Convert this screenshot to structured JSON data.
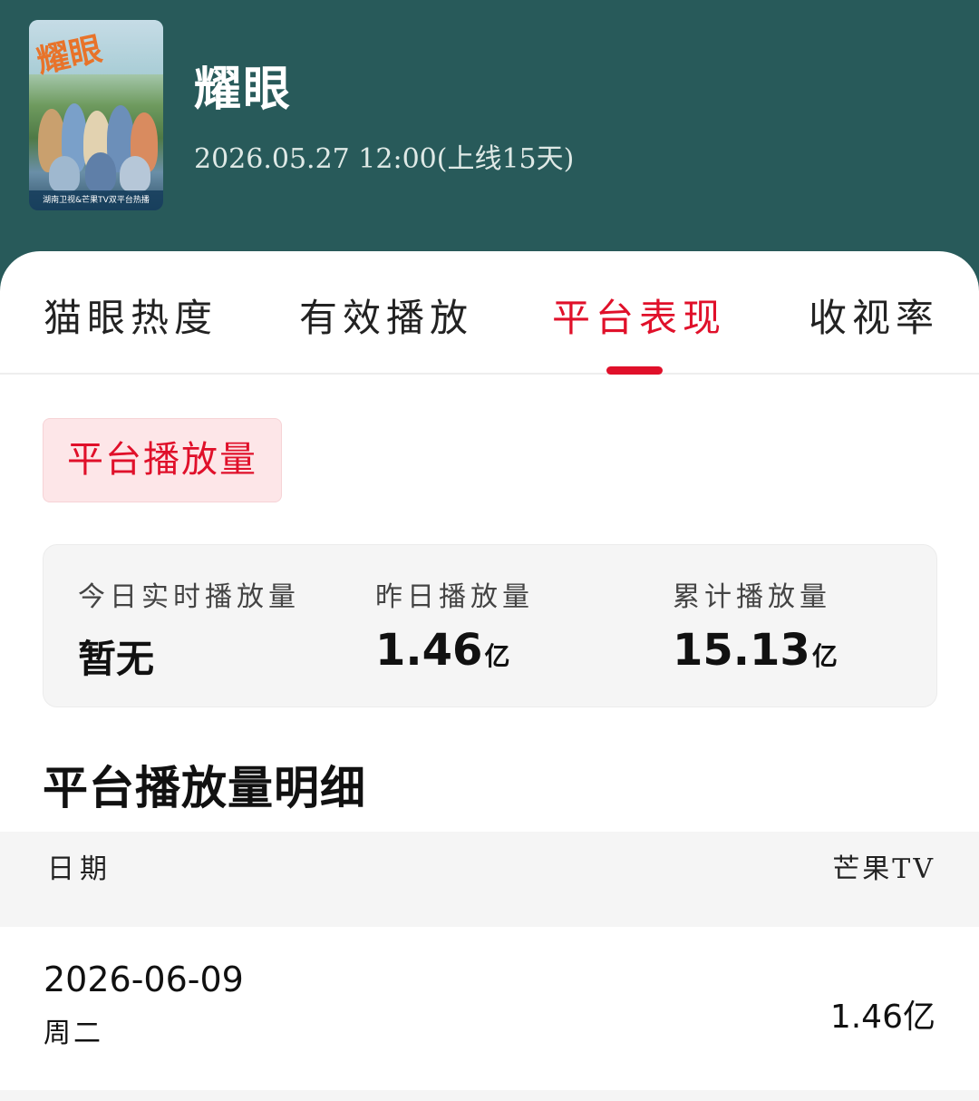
{
  "header": {
    "title": "耀眼",
    "release": "2026.05.27 12:00(上线15天)",
    "poster": {
      "brand_text": "耀眼",
      "bottom_text": "湖南卫视&芒果TV双平台热播"
    }
  },
  "tabs": [
    {
      "label": "猫眼热度",
      "active": false
    },
    {
      "label": "有效播放",
      "active": false
    },
    {
      "label": "平台表现",
      "active": true
    },
    {
      "label": "收视率",
      "active": false
    }
  ],
  "filter": {
    "label": "平台播放量"
  },
  "stats": {
    "today": {
      "label": "今日实时播放量",
      "value": "暂无"
    },
    "yesterday": {
      "label": "昨日播放量",
      "value": "1.46",
      "unit": "亿"
    },
    "total": {
      "label": "累计播放量",
      "value": "15.13",
      "unit": "亿"
    }
  },
  "detail": {
    "title": "平台播放量明细",
    "columns": [
      "日期",
      "芒果TV"
    ],
    "rows": [
      {
        "date": "2026-06-09",
        "weekday": "周二",
        "value": "1.46亿"
      }
    ]
  },
  "colors": {
    "header_bg": "#285a5a",
    "accent": "#e0102a",
    "pill_bg": "#fde6e8"
  }
}
